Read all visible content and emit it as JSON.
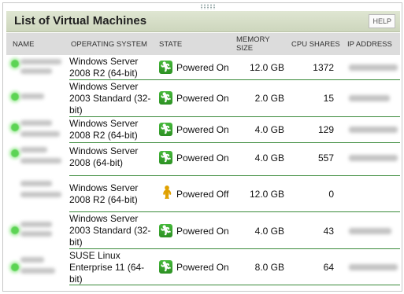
{
  "panel": {
    "title": "List of Virtual Machines",
    "help_label": "HELP"
  },
  "columns": {
    "name": "NAME",
    "os": "OPERATING SYSTEM",
    "state": "STATE",
    "memory": "MEMORY SIZE",
    "cpu": "CPU SHARES",
    "ip": "IP ADDRESS"
  },
  "colors": {
    "accent_green": "#3a8a3a",
    "header_bg": "#cdd6bd",
    "powered_on_icon": "#2c9023",
    "powered_off_icon": "#e0a100"
  },
  "rows": [
    {
      "os": "Windows Server 2008 R2 (64-bit)",
      "state": "Powered On",
      "state_icon": "running-man-icon",
      "memory": "12.0 GB",
      "cpu": "1372"
    },
    {
      "os": "Windows Server 2003 Standard (32-bit)",
      "state": "Powered On",
      "state_icon": "running-man-icon",
      "memory": "2.0 GB",
      "cpu": "15"
    },
    {
      "os": "Windows Server 2008 R2 (64-bit)",
      "state": "Powered On",
      "state_icon": "running-man-icon",
      "memory": "4.0 GB",
      "cpu": "129"
    },
    {
      "os": "Windows Server 2008 (64-bit)",
      "state": "Powered On",
      "state_icon": "running-man-icon",
      "memory": "4.0 GB",
      "cpu": "557"
    },
    {
      "os": "Windows Server 2008 R2 (64-bit)",
      "state": "Powered Off",
      "state_icon": "standing-man-icon",
      "memory": "12.0 GB",
      "cpu": "0"
    },
    {
      "os": "Windows Server 2003 Standard (32-bit)",
      "state": "Powered On",
      "state_icon": "running-man-icon",
      "memory": "4.0 GB",
      "cpu": "43"
    },
    {
      "os": "SUSE Linux Enterprise 11 (64-bit)",
      "state": "Powered On",
      "state_icon": "running-man-icon",
      "memory": "8.0 GB",
      "cpu": "64"
    }
  ]
}
